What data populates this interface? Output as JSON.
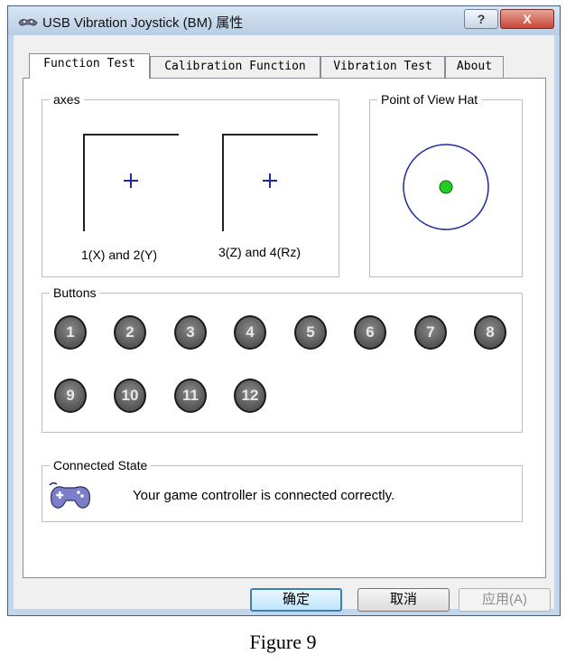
{
  "window": {
    "title": "USB Vibration Joystick (BM) 属性",
    "help_label": "?",
    "close_label": "X"
  },
  "tabs": [
    {
      "label": "Function Test",
      "active": true
    },
    {
      "label": "Calibration Function",
      "active": false
    },
    {
      "label": "Vibration Test",
      "active": false
    },
    {
      "label": "About",
      "active": false
    }
  ],
  "axes": {
    "group_label": "axes",
    "box1_label": "1(X) and 2(Y)",
    "box2_label": "3(Z) and 4(Rz)"
  },
  "pov": {
    "group_label": "Point of View Hat",
    "indicator_color": "#22cc22"
  },
  "buttons": {
    "group_label": "Buttons",
    "items": [
      "1",
      "2",
      "3",
      "4",
      "5",
      "6",
      "7",
      "8",
      "9",
      "10",
      "11",
      "12"
    ]
  },
  "status": {
    "group_label": "Connected State",
    "message": "Your game controller is connected correctly.",
    "icon": "gamepad-icon"
  },
  "footer": {
    "ok_label": "确定",
    "cancel_label": "取消",
    "apply_label": "应用(A)"
  },
  "caption": "Figure 9",
  "colors": {
    "accent": "#3c7fb1",
    "crosshair": "#1e2aa0",
    "close": "#c6463a"
  }
}
